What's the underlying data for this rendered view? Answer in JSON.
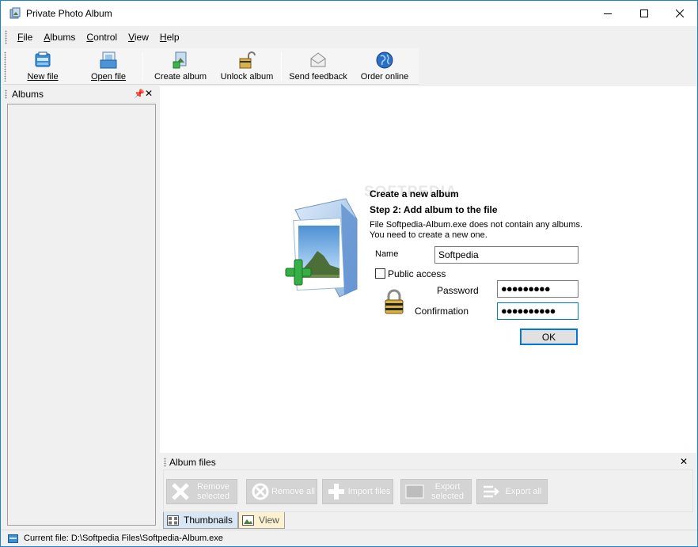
{
  "window": {
    "title": "Private Photo Album"
  },
  "menu": [
    {
      "label": "File",
      "mnemonic": "F",
      "rest": "ile"
    },
    {
      "label": "Albums",
      "mnemonic": "A",
      "rest": "lbums"
    },
    {
      "label": "Control",
      "mnemonic": "C",
      "rest": "ontrol"
    },
    {
      "label": "View",
      "mnemonic": "V",
      "rest": "iew"
    },
    {
      "label": "Help",
      "mnemonic": "H",
      "rest": "elp"
    }
  ],
  "toolbar": {
    "new_file": "New file",
    "open_file": "Open file",
    "create_album": "Create album",
    "unlock_album": "Unlock album",
    "send_feedback": "Send feedback",
    "order_online": "Order online"
  },
  "albums_pane": {
    "title": "Albums"
  },
  "wizard": {
    "title": "Create a new album",
    "step": "Step 2: Add album to the file",
    "message_line1": "File Softpedia-Album.exe does not contain any albums.",
    "message_line2": "You need to create a new one.",
    "name_label": "Name",
    "name_value": "Softpedia",
    "public_access_label": "Public access",
    "public_access_checked": false,
    "password_label": "Password",
    "password_value": "●●●●●●●●●",
    "confirmation_label": "Confirmation",
    "confirmation_value": "●●●●●●●●●●",
    "ok_label": "OK",
    "watermark": "SOFTPEDIA"
  },
  "files_pane": {
    "title": "Album files",
    "remove_selected": [
      "Remove",
      "selected"
    ],
    "remove_all": "Remove all",
    "import_files": "Import files",
    "export_selected": [
      "Export",
      "selected"
    ],
    "export_all": "Export all",
    "tab_thumbnails": "Thumbnails",
    "tab_view": "View"
  },
  "status": {
    "current_file": "Current file: D:\\Softpedia Files\\Softpedia-Album.exe"
  },
  "colors": {
    "accent": "#0078d7",
    "border": "#1883d7",
    "disabled_button": "#d4d4d4"
  }
}
